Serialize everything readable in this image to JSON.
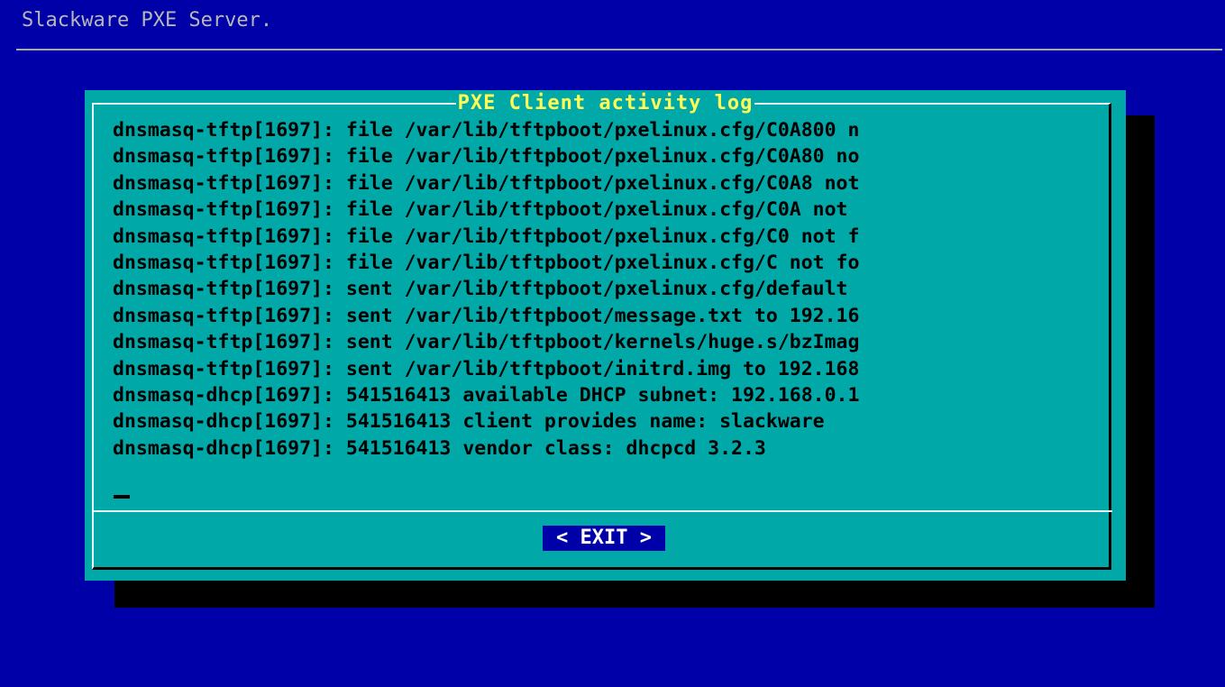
{
  "screen": {
    "title": "Slackware PXE Server."
  },
  "dialog": {
    "title": "PXE Client activity log",
    "log_lines": [
      "dnsmasq-tftp[1697]: file /var/lib/tftpboot/pxelinux.cfg/C0A800 n",
      "dnsmasq-tftp[1697]: file /var/lib/tftpboot/pxelinux.cfg/C0A80 no",
      "dnsmasq-tftp[1697]: file /var/lib/tftpboot/pxelinux.cfg/C0A8 not",
      "dnsmasq-tftp[1697]: file /var/lib/tftpboot/pxelinux.cfg/C0A not",
      "dnsmasq-tftp[1697]: file /var/lib/tftpboot/pxelinux.cfg/C0 not f",
      "dnsmasq-tftp[1697]: file /var/lib/tftpboot/pxelinux.cfg/C not fo",
      "dnsmasq-tftp[1697]: sent /var/lib/tftpboot/pxelinux.cfg/default",
      "dnsmasq-tftp[1697]: sent /var/lib/tftpboot/message.txt to 192.16",
      "dnsmasq-tftp[1697]: sent /var/lib/tftpboot/kernels/huge.s/bzImag",
      "dnsmasq-tftp[1697]: sent /var/lib/tftpboot/initrd.img to 192.168",
      "dnsmasq-dhcp[1697]: 541516413 available DHCP subnet: 192.168.0.1",
      "dnsmasq-dhcp[1697]: 541516413 client provides name: slackware",
      "dnsmasq-dhcp[1697]: 541516413 vendor class: dhcpcd 3.2.3"
    ],
    "exit_label": "< EXIT >"
  },
  "colors": {
    "background": "#0000a8",
    "dialog": "#00a8a8",
    "title_text": "#ffff54",
    "button_bg": "#0000a8"
  }
}
